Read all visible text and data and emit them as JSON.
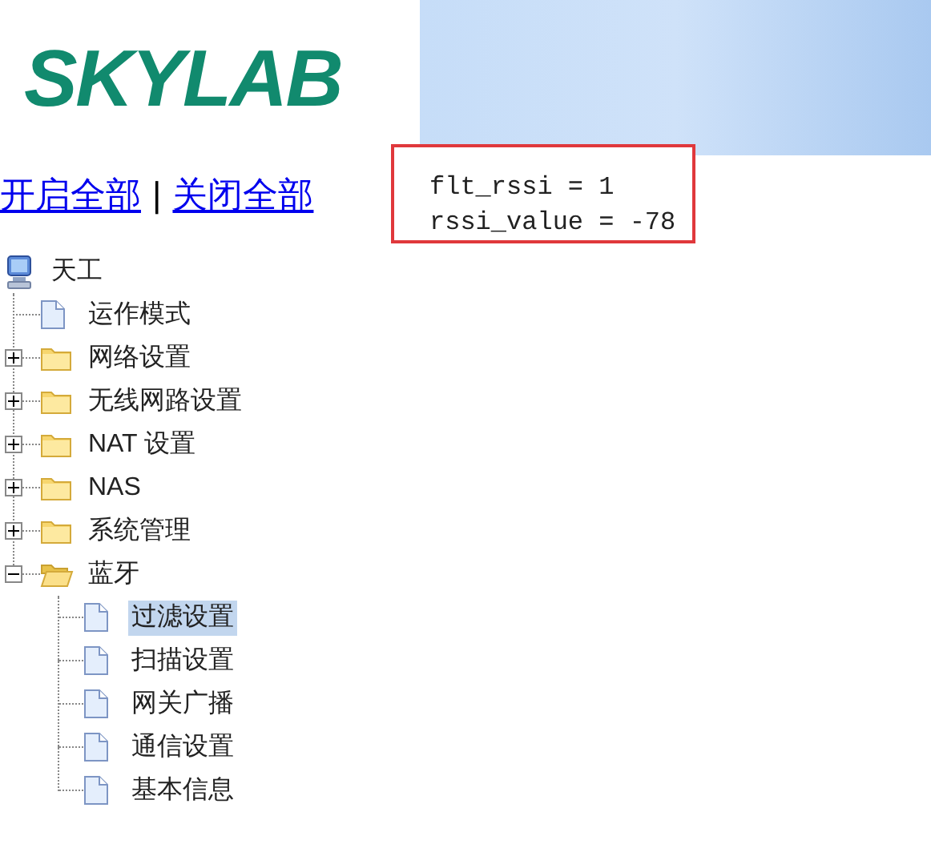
{
  "logo": {
    "text": "SKYLAB"
  },
  "links": [
    {
      "label": "开启全部"
    },
    {
      "label": "关闭全部"
    }
  ],
  "separator": "|",
  "output": {
    "lines": [
      "flt_rssi = 1",
      "rssi_value = -78"
    ]
  },
  "tree": {
    "label": "天工",
    "kind": "computer",
    "selected": false,
    "children": [
      {
        "label": "运作模式",
        "kind": "page",
        "selected": false
      },
      {
        "label": "网络设置",
        "kind": "folder",
        "expanded": false,
        "selected": false
      },
      {
        "label": "无线网路设置",
        "kind": "folder",
        "expanded": false,
        "selected": false
      },
      {
        "label": "NAT 设置",
        "kind": "folder",
        "expanded": false,
        "selected": false
      },
      {
        "label": "NAS",
        "kind": "folder",
        "expanded": false,
        "selected": false
      },
      {
        "label": "系统管理",
        "kind": "folder",
        "expanded": false,
        "selected": false
      },
      {
        "label": "蓝牙",
        "kind": "folder",
        "expanded": true,
        "selected": false,
        "children": [
          {
            "label": "过滤设置",
            "kind": "page",
            "selected": true
          },
          {
            "label": "扫描设置",
            "kind": "page",
            "selected": false
          },
          {
            "label": "网关广播",
            "kind": "page",
            "selected": false
          },
          {
            "label": "通信设置",
            "kind": "page",
            "selected": false
          },
          {
            "label": "基本信息",
            "kind": "page",
            "selected": false
          }
        ]
      }
    ]
  }
}
